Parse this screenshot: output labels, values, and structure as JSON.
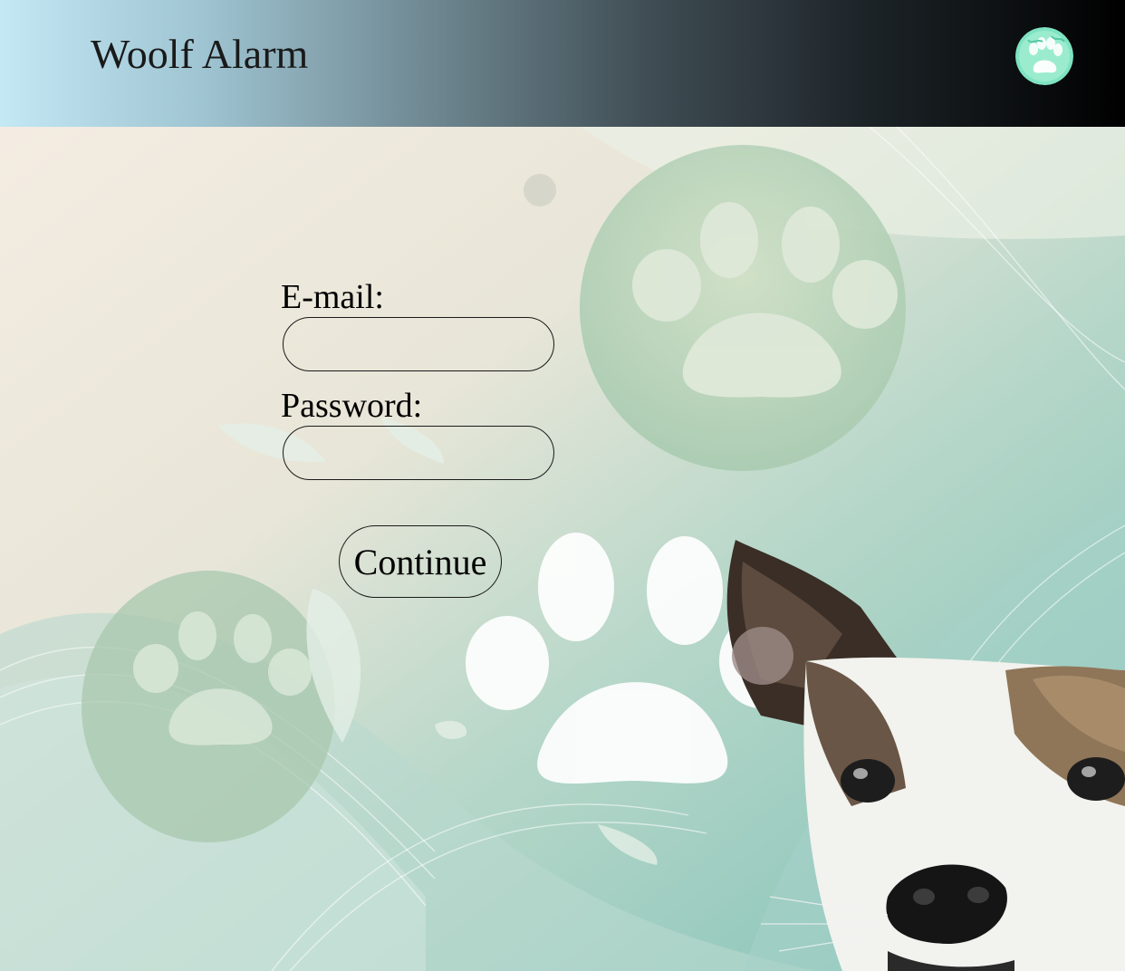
{
  "header": {
    "title": "Woolf Alarm",
    "avatar_icon": "paw-print-icon"
  },
  "login_form": {
    "email_label": "E-mail:",
    "email_value": "",
    "password_label": "Password:",
    "password_value": "",
    "continue_label": "Continue"
  },
  "background": {
    "pattern_icon": "paw-print-icon",
    "illustration": "dog-icon"
  },
  "colors": {
    "header_gradient_start": "#c4e8f4",
    "header_gradient_end": "#000000",
    "avatar_fill": "#7fe3c2",
    "background_cream": "#f3ebe0",
    "background_teal": "#8cc7bd"
  }
}
